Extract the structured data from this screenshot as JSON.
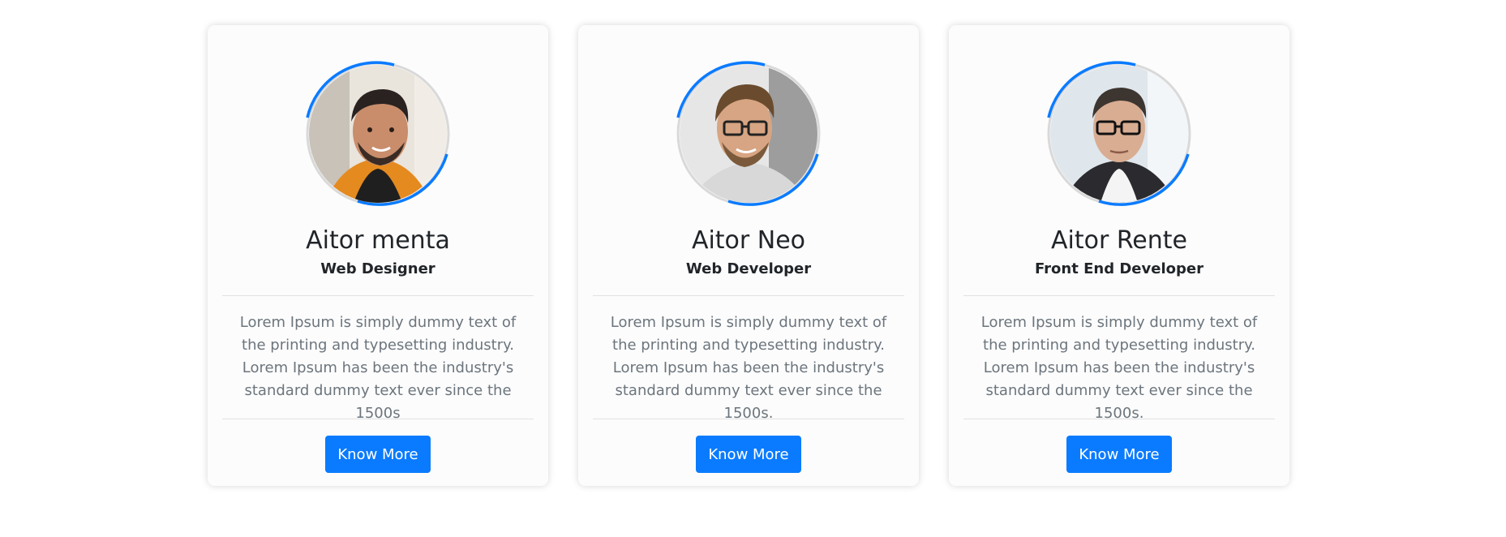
{
  "accent_color": "#0a7bff",
  "cards": [
    {
      "avatar": "person-photo-icon",
      "name": "Aitor menta",
      "role": "Web Designer",
      "description": "Lorem Ipsum is simply dummy text of the printing and typesetting industry. Lorem Ipsum has been the industry's standard dummy text ever since the 1500s",
      "button_label": "Know More"
    },
    {
      "avatar": "person-photo-icon",
      "name": "Aitor Neo",
      "role": "Web Developer",
      "description": "Lorem Ipsum is simply dummy text of the printing and typesetting industry. Lorem Ipsum has been the industry's standard dummy text ever since the 1500s.",
      "button_label": "Know More"
    },
    {
      "avatar": "person-photo-icon",
      "name": "Aitor Rente",
      "role": "Front End Developer",
      "description": "Lorem Ipsum is simply dummy text of the printing and typesetting industry. Lorem Ipsum has been the industry's standard dummy text ever since the 1500s.",
      "button_label": "Know More"
    }
  ]
}
